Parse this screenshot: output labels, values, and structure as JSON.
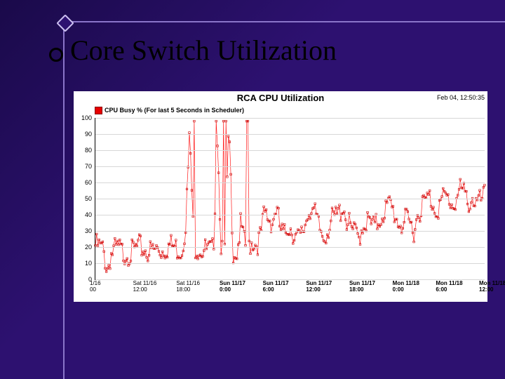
{
  "slide": {
    "title": "Core Switch Utilization"
  },
  "chart_data": {
    "type": "line",
    "title": "RCA CPU Utilization",
    "timestamp": "Feb 04, 12:50:35",
    "legend": {
      "label": "CPU Busy % (For last 5 Seconds in Scheduler)"
    },
    "ylabel": "",
    "ylim": [
      0,
      100
    ],
    "yticks": [
      0,
      10,
      20,
      30,
      40,
      50,
      60,
      70,
      80,
      90,
      100
    ],
    "xticks": [
      "1/16\n00",
      "Sat 11/16\n12:00",
      "Sat 11/16\n18:00",
      "Sun 11/17\n0:00",
      "Sun 11/17\n6:00",
      "Sun 11/17\n12:00",
      "Sun 11/17\n18:00",
      "Mon 11/18\n0:00",
      "Mon 11/18\n6:00",
      "Mon 11/18\n12:00"
    ],
    "series": [
      {
        "name": "CPU Busy %",
        "color": "#e70000",
        "approx_values_per_xtick_segment": [
          25,
          24,
          22,
          10,
          20,
          22,
          23,
          20,
          21,
          20,
          22,
          24,
          23,
          22,
          21,
          22,
          23,
          22,
          24,
          25,
          24,
          23,
          22,
          40,
          95,
          25,
          24,
          23,
          22,
          21,
          22,
          95,
          24,
          23,
          98,
          22,
          21,
          38,
          24,
          25,
          28,
          26,
          30,
          45,
          42,
          40,
          48,
          35,
          30,
          38,
          35,
          30,
          28,
          35,
          45,
          50,
          42,
          35,
          30,
          35,
          40,
          42,
          45,
          50,
          40,
          35,
          32,
          30,
          38,
          40,
          38,
          36,
          40,
          45,
          48,
          50,
          45,
          40,
          38,
          40,
          38,
          35,
          45,
          50,
          52,
          55,
          50,
          48,
          52,
          55,
          53,
          50,
          55,
          60,
          55,
          52,
          55,
          50,
          52,
          55
        ],
        "spikes_at_approx_x_fraction": [
          0.255,
          0.31,
          0.33,
          0.335,
          0.39
        ],
        "spike_value": 98
      }
    ]
  }
}
